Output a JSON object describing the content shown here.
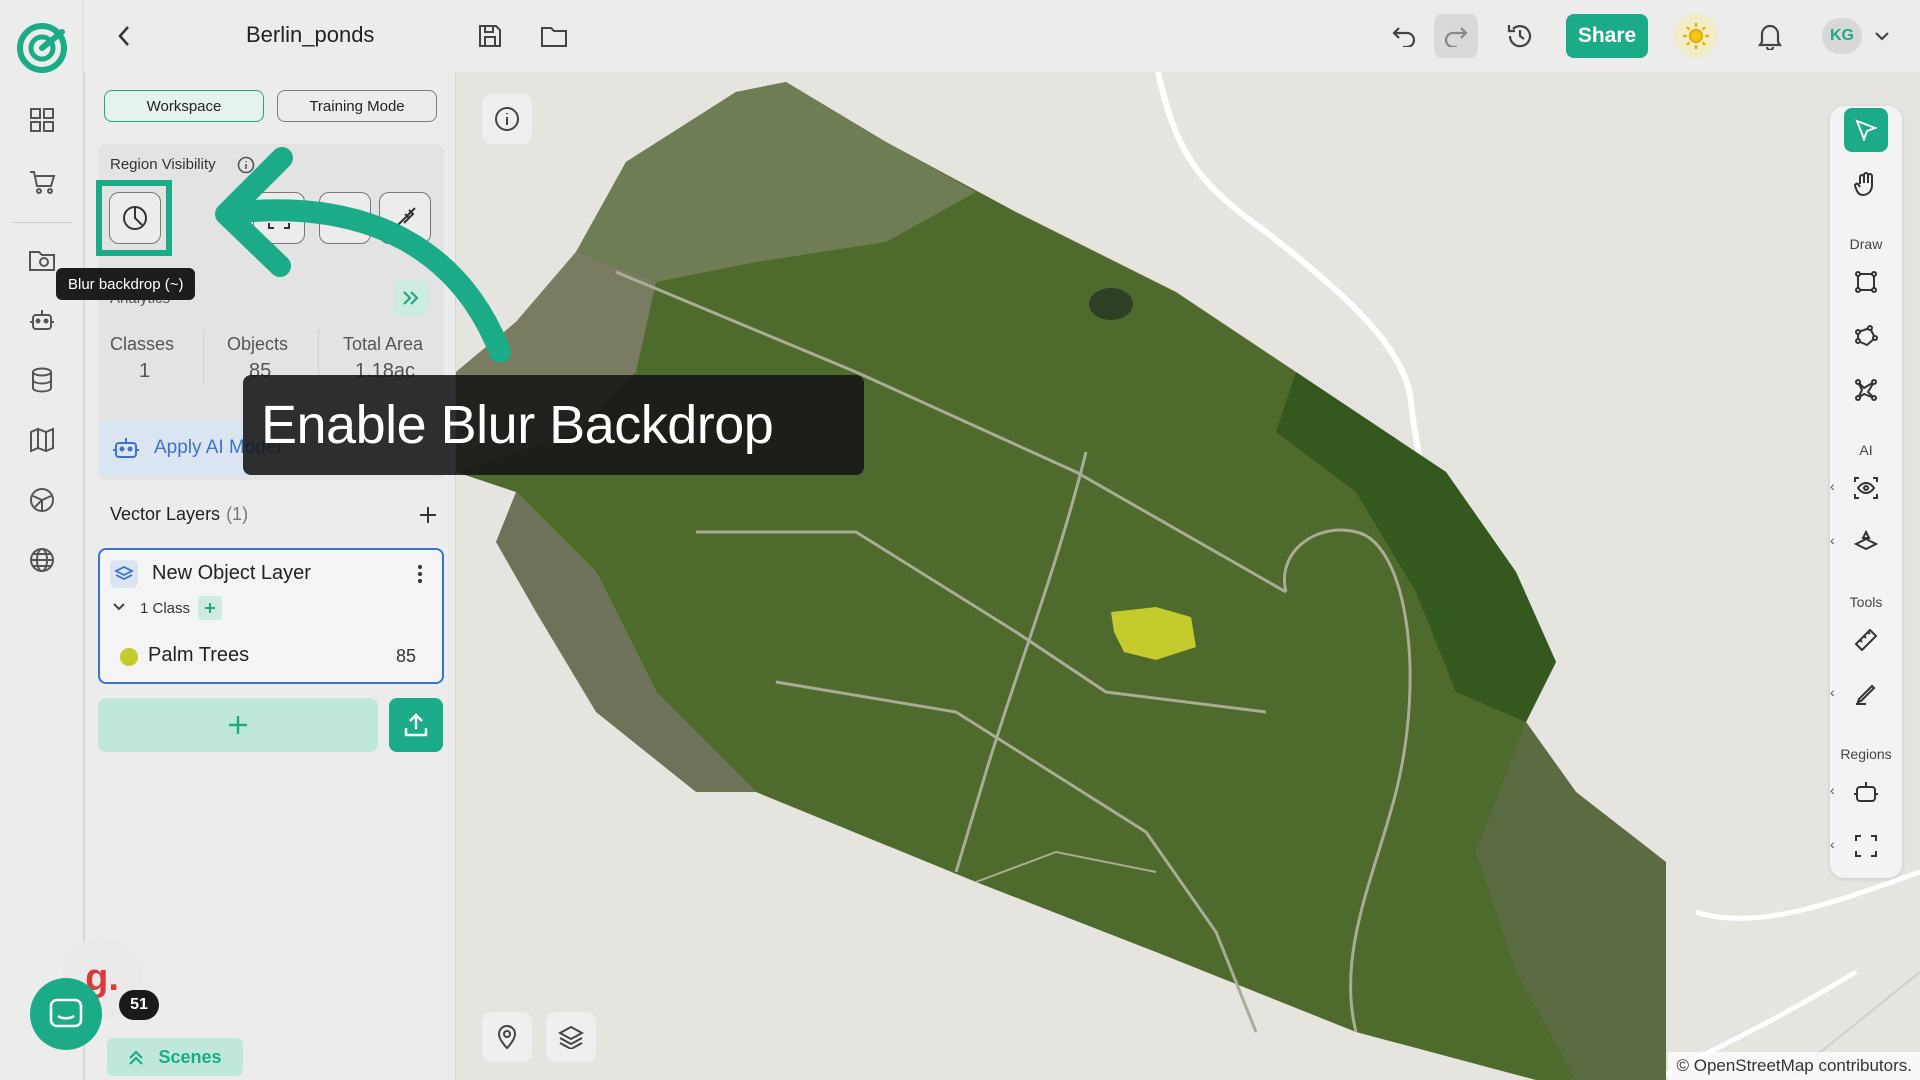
{
  "header": {
    "title": "Berlin_ponds",
    "share_label": "Share",
    "avatar_initials": "KG"
  },
  "panel": {
    "workspace_label": "Workspace",
    "training_label": "Training Mode",
    "region_visibility_label": "Region Visibility",
    "analytics_label": "Analytics",
    "stats": {
      "classes_label": "Classes",
      "classes_value": "1",
      "objects_label": "Objects",
      "objects_value": "85",
      "area_label": "Total Area",
      "area_value": "1.18ac"
    },
    "apply_ai_label": "Apply AI Model",
    "vector_layers_label": "Vector Layers",
    "vector_layers_count": "(1)",
    "layer": {
      "name": "New Object Layer",
      "class_count_label": "1 Class",
      "class_name": "Palm Trees",
      "class_count": "85",
      "class_color": "#c3cc2c"
    }
  },
  "tooltip": {
    "text": "Blur backdrop (~)"
  },
  "callout": {
    "text": "Enable Blur Backdrop"
  },
  "toolbar": {
    "draw_label": "Draw",
    "ai_label": "AI",
    "tools_label": "Tools",
    "regions_label": "Regions"
  },
  "map": {
    "attribution": "© OpenStreetMap contributors."
  },
  "footer": {
    "scenes_label": "Scenes",
    "chat_badge": "51",
    "g_label": "g."
  },
  "colors": {
    "accent": "#1bab86",
    "link_blue": "#3a74c9"
  }
}
